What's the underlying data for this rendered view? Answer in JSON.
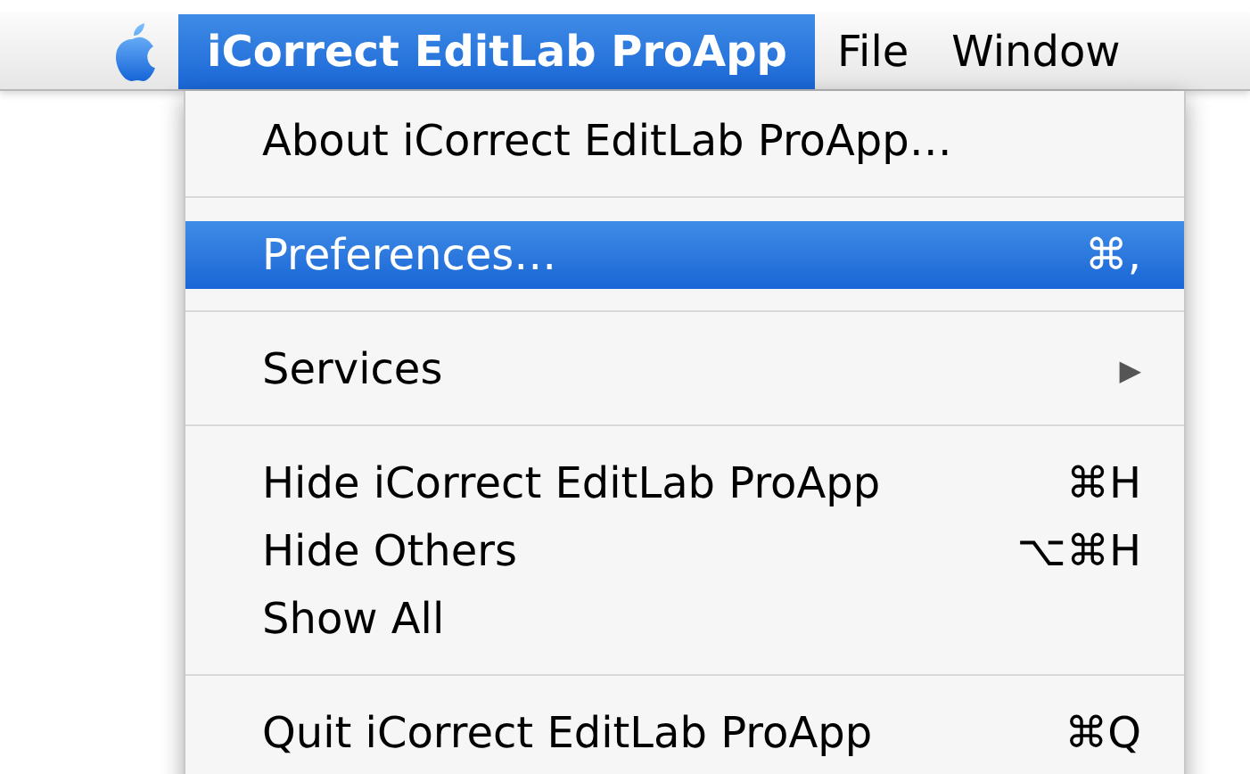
{
  "menu_bar": {
    "items": [
      {
        "kind": "logo",
        "selected": false
      },
      {
        "kind": "app",
        "label": "iCorrect EditLab ProApp",
        "selected": true
      },
      {
        "kind": "menu",
        "label": "File",
        "selected": false
      },
      {
        "kind": "menu",
        "label": "Window",
        "selected": false
      }
    ]
  },
  "menu": {
    "items": [
      {
        "kind": "item",
        "label": "About iCorrect EditLab ProApp…",
        "selected": false
      },
      {
        "kind": "separator"
      },
      {
        "kind": "item",
        "label": "Preferences…",
        "shortcut": "⌘,",
        "selected": true
      },
      {
        "kind": "separator"
      },
      {
        "kind": "item",
        "label": "Services",
        "submenu_arrow": "▶",
        "selected": false
      },
      {
        "kind": "separator"
      },
      {
        "kind": "item",
        "label": "Hide iCorrect EditLab ProApp",
        "shortcut": "⌘H",
        "selected": false
      },
      {
        "kind": "item",
        "label": "Hide Others",
        "shortcut": "⌥⌘H",
        "selected": false
      },
      {
        "kind": "item",
        "label": "Show All",
        "selected": false
      },
      {
        "kind": "separator"
      },
      {
        "kind": "item",
        "label": "Quit iCorrect EditLab ProApp",
        "shortcut": "⌘Q",
        "selected": false
      }
    ]
  }
}
